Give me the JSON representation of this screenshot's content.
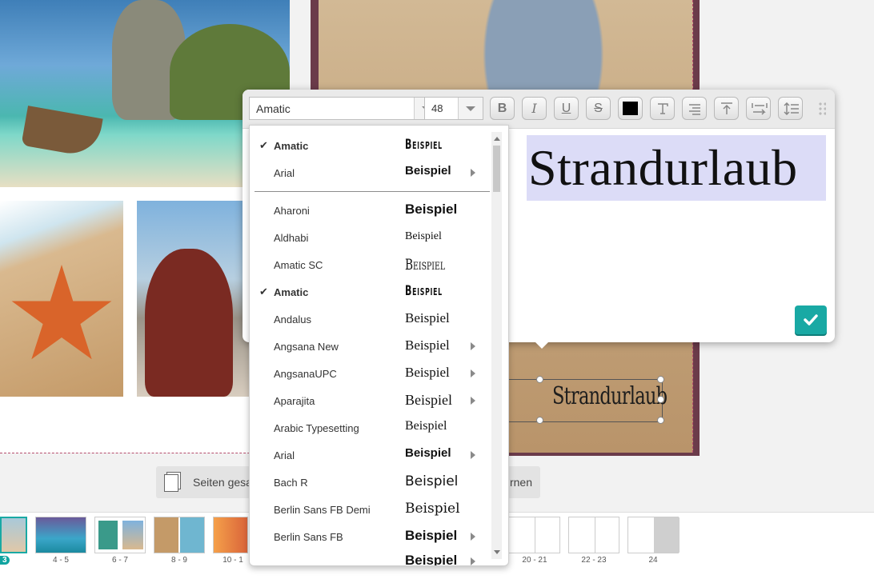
{
  "editor": {
    "font_value": "Amatic",
    "size_value": "48",
    "text": "Strandurlaub",
    "color_swatch": "#000000"
  },
  "canvas": {
    "selected_text": "Strandurlaub"
  },
  "toolbar_chip": {
    "label_left": "Seiten gesa",
    "label_right": "rnen"
  },
  "font_menu": {
    "recent": [
      {
        "name": "Amatic",
        "sample": "Beispiel",
        "checked": true,
        "submenu": false
      },
      {
        "name": "Arial",
        "sample": "Beispiel",
        "checked": false,
        "submenu": true
      }
    ],
    "all": [
      {
        "name": "Aharoni",
        "sample": "Beispiel",
        "checked": false,
        "submenu": false
      },
      {
        "name": "Aldhabi",
        "sample": "Beispiel",
        "checked": false,
        "submenu": false
      },
      {
        "name": "Amatic SC",
        "sample": "Beispiel",
        "checked": false,
        "submenu": false
      },
      {
        "name": "Amatic",
        "sample": "Beispiel",
        "checked": true,
        "submenu": false
      },
      {
        "name": "Andalus",
        "sample": "Beispiel",
        "checked": false,
        "submenu": false
      },
      {
        "name": "Angsana New",
        "sample": "Beispiel",
        "checked": false,
        "submenu": true
      },
      {
        "name": "AngsanaUPC",
        "sample": "Beispiel",
        "checked": false,
        "submenu": true
      },
      {
        "name": "Aparajita",
        "sample": "Beispiel",
        "checked": false,
        "submenu": true
      },
      {
        "name": "Arabic Typesetting",
        "sample": "Beispiel",
        "checked": false,
        "submenu": false
      },
      {
        "name": "Arial",
        "sample": "Beispiel",
        "checked": false,
        "submenu": true
      },
      {
        "name": "Bach R",
        "sample": "Beispiel",
        "checked": false,
        "submenu": false
      },
      {
        "name": "Berlin Sans FB Demi",
        "sample": "Beispiel",
        "checked": false,
        "submenu": false
      },
      {
        "name": "Berlin Sans FB",
        "sample": "Beispiel",
        "checked": false,
        "submenu": true
      },
      {
        "name": "",
        "sample": "Beispiel",
        "checked": false,
        "submenu": true
      }
    ]
  },
  "pages": {
    "current_badge": "3",
    "labels": [
      "4 - 5",
      "6 - 7",
      "8 - 9",
      "10 - 1",
      "20 - 21",
      "22 - 23",
      "24"
    ]
  },
  "icons": {
    "check": "✔",
    "checkmark_confirm": "check-icon"
  },
  "colors": {
    "accent": "#19a9a4",
    "selection": "#dcdcf7",
    "canvas_border": "#b54b6b"
  }
}
